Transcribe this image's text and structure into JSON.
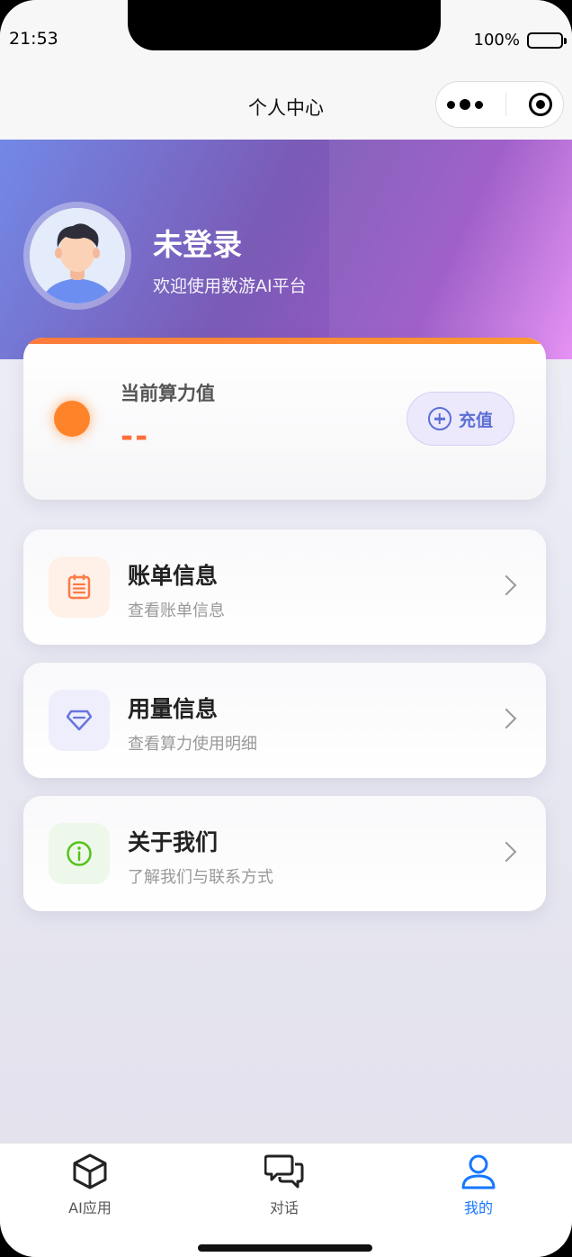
{
  "status_bar": {
    "time": "21:53",
    "battery": "100%"
  },
  "nav": {
    "title": "个人中心"
  },
  "profile": {
    "name": "未登录",
    "welcome": "欢迎使用数游AI平台"
  },
  "power": {
    "label": "当前算力值",
    "value": "--",
    "recharge_label": "充值"
  },
  "menu": [
    {
      "title": "账单信息",
      "subtitle": "查看账单信息",
      "icon": "bill-icon"
    },
    {
      "title": "用量信息",
      "subtitle": "查看算力使用明细",
      "icon": "diamond-icon"
    },
    {
      "title": "关于我们",
      "subtitle": "了解我们与联系方式",
      "icon": "info-icon"
    }
  ],
  "tabs": [
    {
      "label": "AI应用",
      "icon": "cube-icon"
    },
    {
      "label": "对话",
      "icon": "chat-icon"
    },
    {
      "label": "我的",
      "icon": "user-icon",
      "active": true
    }
  ],
  "colors": {
    "accent": "#1677ff",
    "power_orange": "#ff8328",
    "recharge": "#5c6fd6",
    "bill": "#ff7a45",
    "usage": "#6675dd",
    "about": "#52c41a"
  }
}
